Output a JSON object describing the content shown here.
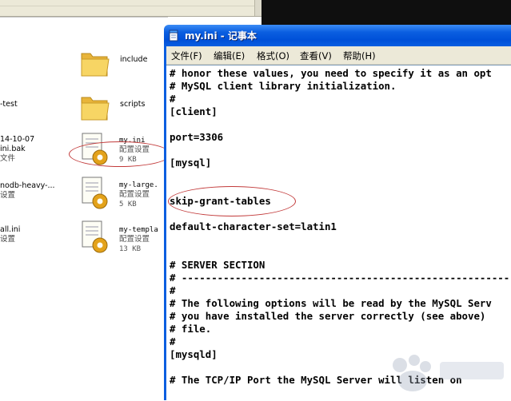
{
  "explorer": {
    "left_column": [
      {
        "text": "-test"
      },
      {
        "text": "14-10-07"
      },
      {
        "text": "ini.bak"
      },
      {
        "text": "文件"
      },
      {
        "text": "nodb-heavy-..."
      },
      {
        "text": "设置"
      },
      {
        "text": "all.ini"
      },
      {
        "text": "设置"
      }
    ],
    "items": [
      {
        "name": "include",
        "type": "",
        "size": ""
      },
      {
        "name": "scripts",
        "type": "",
        "size": ""
      },
      {
        "name": "my.ini",
        "type": "配置设置",
        "size": "9 KB"
      },
      {
        "name": "my-large.",
        "type": "配置设置",
        "size": "5 KB"
      },
      {
        "name": "my-templa",
        "type": "配置设置",
        "size": "13 KB"
      }
    ]
  },
  "notepad": {
    "title": "my.ini - 记事本",
    "menu": [
      "文件(F)",
      "编辑(E)",
      "格式(O)",
      "查看(V)",
      "帮助(H)"
    ],
    "lines": [
      "# honor these values, you need to specify it as an opt",
      "# MySQL client library initialization.",
      "#",
      "[client]",
      "",
      "port=3306",
      "",
      "[mysql]",
      "",
      "",
      "skip-grant-tables",
      "",
      "default-character-set=latin1",
      "",
      "",
      "# SERVER SECTION",
      "# -------------------------------------------------------",
      "#",
      "# The following options will be read by the MySQL Serv",
      "# you have installed the server correctly (see above)",
      "# file.",
      "#",
      "[mysqld]",
      "",
      "# The TCP/IP Port the MySQL Server will listen on"
    ]
  },
  "colors": {
    "titlebar": "#0a5ee0",
    "menubar": "#ece9d8",
    "highlight_ellipse": "#c23a3a"
  },
  "icons": {
    "folder": "folder-icon",
    "config_file": "config-file-icon",
    "notepad": "notepad-icon"
  }
}
